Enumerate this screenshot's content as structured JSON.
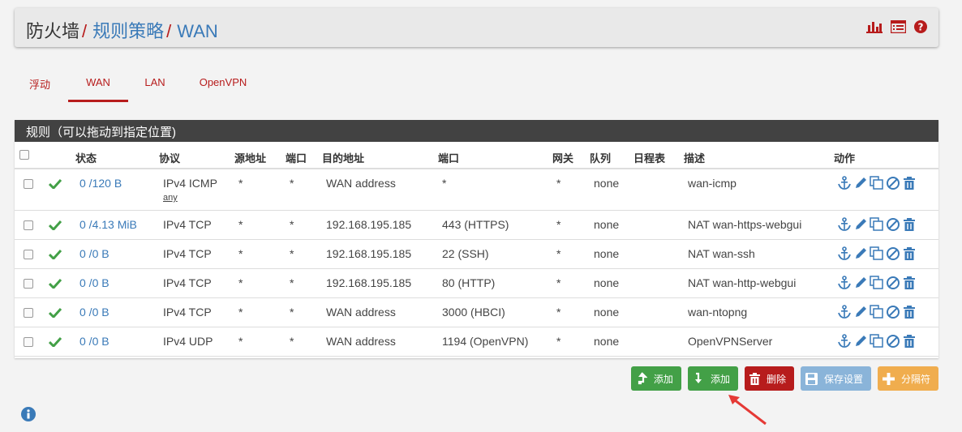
{
  "breadcrumb": {
    "root": "防火墙",
    "sep": "/",
    "level1": "规则策略",
    "level2": "WAN"
  },
  "header_icons": [
    "bar-chart-icon",
    "list-table-icon",
    "help-circle-icon"
  ],
  "tabs": [
    {
      "label": "浮动"
    },
    {
      "label": "WAN",
      "active": true
    },
    {
      "label": "LAN"
    },
    {
      "label": "OpenVPN"
    }
  ],
  "panel": {
    "title": "规则（可以拖动到指定位置)",
    "columns": {
      "status": "状态",
      "protocol": "协议",
      "source": "源地址",
      "src_port": "端口",
      "destination": "目的地址",
      "dst_port": "端口",
      "gateway": "网关",
      "queue": "队列",
      "schedule": "日程表",
      "description": "描述",
      "actions": "动作"
    }
  },
  "rules": [
    {
      "states": "0 /120 B",
      "protocol": "IPv4 ICMP",
      "protocol_sub": "any",
      "source": "*",
      "src_port": "*",
      "destination": "WAN address",
      "dst_port": "*",
      "gateway": "*",
      "queue": "none",
      "schedule": "",
      "description": "wan-icmp"
    },
    {
      "states": "0 /4.13 MiB",
      "protocol": "IPv4 TCP",
      "source": "*",
      "src_port": "*",
      "destination": "192.168.195.185",
      "dst_port": "443 (HTTPS)",
      "gateway": "*",
      "queue": "none",
      "schedule": "",
      "description": "NAT wan-https-webgui"
    },
    {
      "states": "0 /0 B",
      "protocol": "IPv4 TCP",
      "source": "*",
      "src_port": "*",
      "destination": "192.168.195.185",
      "dst_port": "22 (SSH)",
      "gateway": "*",
      "queue": "none",
      "schedule": "",
      "description": "NAT wan-ssh"
    },
    {
      "states": "0 /0 B",
      "protocol": "IPv4 TCP",
      "source": "*",
      "src_port": "*",
      "destination": "192.168.195.185",
      "dst_port": "80 (HTTP)",
      "gateway": "*",
      "queue": "none",
      "schedule": "",
      "description": "NAT wan-http-webgui"
    },
    {
      "states": "0 /0 B",
      "protocol": "IPv4 TCP",
      "source": "*",
      "src_port": "*",
      "destination": "WAN address",
      "dst_port": "3000 (HBCI)",
      "gateway": "*",
      "queue": "none",
      "schedule": "",
      "description": "wan-ntopng"
    },
    {
      "states": "0 /0 B",
      "protocol": "IPv4 UDP",
      "source": "*",
      "src_port": "*",
      "destination": "WAN address",
      "dst_port": "1194 (OpenVPN)",
      "gateway": "*",
      "queue": "none",
      "schedule": "",
      "description": "OpenVPNServer"
    }
  ],
  "buttons": {
    "add_top": "添加",
    "add_bottom": "添加",
    "delete": "删除",
    "save": "保存设置",
    "separator": "分隔符"
  },
  "colors": {
    "accent_red": "#b71c1c",
    "link_blue": "#3a7ab8",
    "green": "#43a047",
    "panel_head": "#424242"
  }
}
